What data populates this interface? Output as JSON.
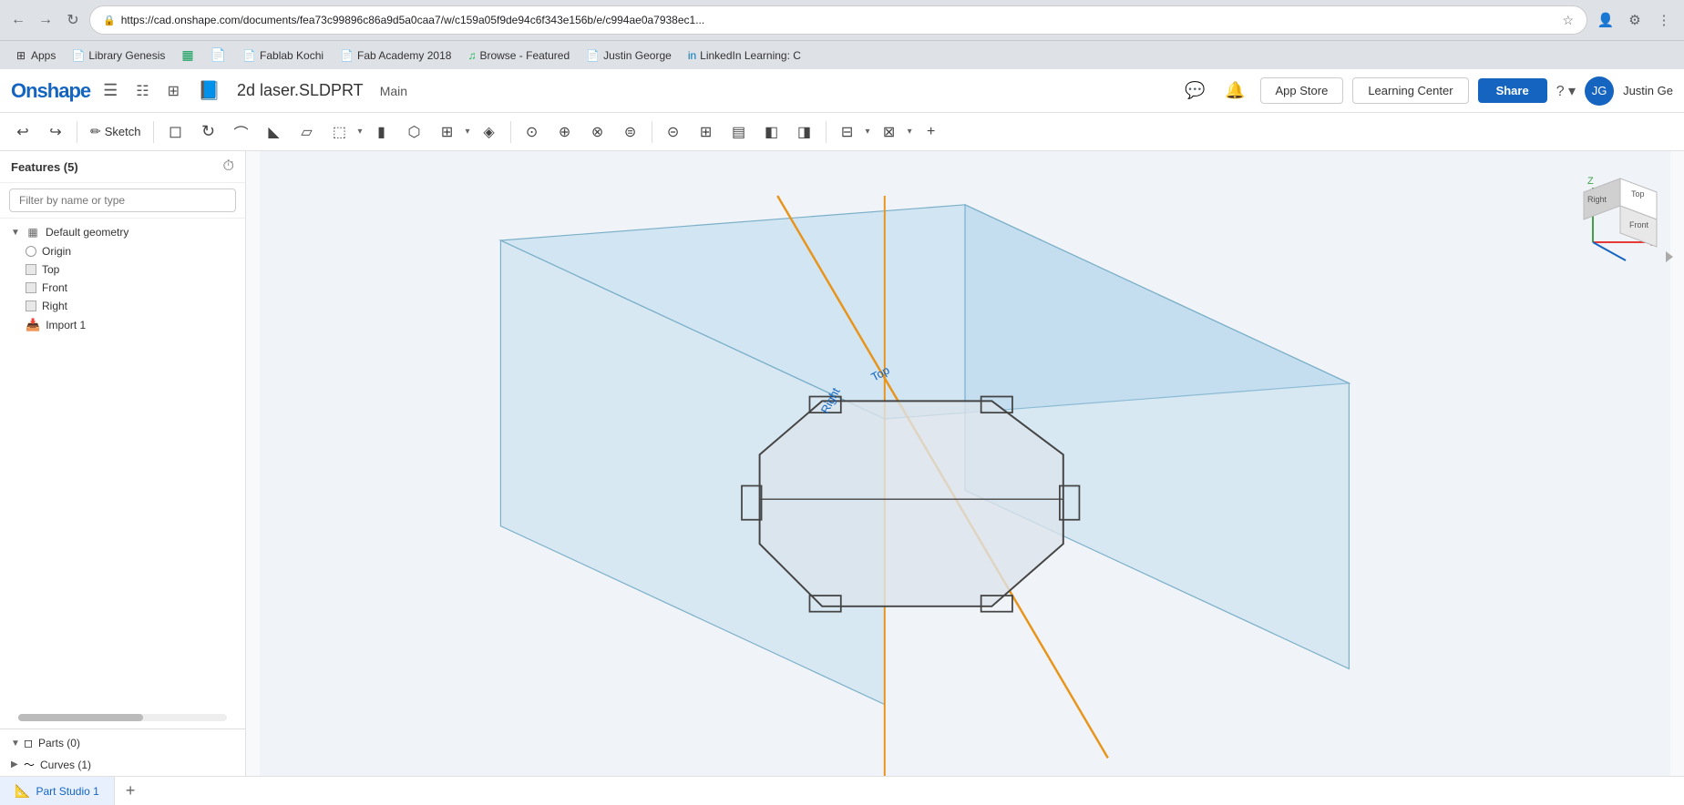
{
  "browser": {
    "url": "https://cad.onshape.com/documents/fea73c99896c86a9d5a0caa7/w/c159a05f9de94c6f343e156b/e/c994ae0a7938ec1...",
    "back_btn": "←",
    "forward_btn": "→",
    "refresh_btn": "↻",
    "secure_label": "Secure",
    "bookmarks": [
      {
        "id": "apps",
        "label": "Apps"
      },
      {
        "id": "library-genesis",
        "label": "Library Genesis"
      },
      {
        "id": "gsheets",
        "label": ""
      },
      {
        "id": "gdoc",
        "label": ""
      },
      {
        "id": "fablab",
        "label": "Fablab Kochi"
      },
      {
        "id": "fab-academy",
        "label": "Fab Academy 2018"
      },
      {
        "id": "spotify",
        "label": "Browse - Featured"
      },
      {
        "id": "justin",
        "label": "Justin George"
      },
      {
        "id": "linkedin",
        "label": "LinkedIn Learning: C"
      }
    ]
  },
  "header": {
    "logo": "Onshape",
    "doc_title": "2d laser.SLDPRT",
    "doc_badge": "📘",
    "main_tag": "Main",
    "app_store_label": "App Store",
    "learning_center_label": "Learning Center",
    "share_label": "Share",
    "user_initials": "JG",
    "user_name": "Justin Ge"
  },
  "toolbar": {
    "undo": "↩",
    "redo": "↪",
    "sketch": "Sketch",
    "tools": [
      "▭",
      "⬡",
      "◎",
      "⌒",
      "◣",
      "▱",
      "⬚",
      "▮",
      "⊞",
      "◈",
      "⊙",
      "⊕",
      "⊗",
      "⊜",
      "⊝",
      "⊞",
      "▤",
      "◧",
      "◨",
      "⊟",
      "⊠",
      "⊡",
      "+"
    ]
  },
  "features_panel": {
    "title": "Features (5)",
    "search_placeholder": "Filter by name or type",
    "tree": {
      "default_geometry": "Default geometry",
      "origin": "Origin",
      "top": "Top",
      "front": "Front",
      "right": "Right",
      "import1": "Import 1"
    },
    "parts": {
      "label": "Parts (0)"
    },
    "curves": {
      "label": "Curves (1)"
    }
  },
  "canvas": {
    "bg_color": "#f0f4f8",
    "plane_color": "#c8d8ea",
    "shape_stroke": "#555",
    "orange_line": "#e8941a",
    "axis_x_color": "#e53935",
    "axis_y_color": "#43a047",
    "axis_z_color": "#1565c0",
    "top_label": "Top",
    "right_label": "Right",
    "front_label": "Front"
  },
  "tabs": [
    {
      "id": "part-studio-1",
      "label": "Part Studio 1",
      "active": true
    }
  ]
}
